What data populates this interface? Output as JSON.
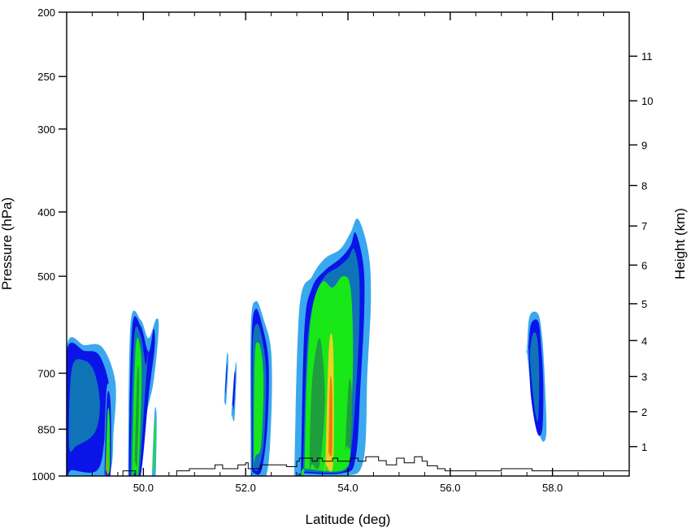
{
  "chart_data": {
    "type": "contour",
    "title": "",
    "xlabel": "Latitude (deg)",
    "ylabel": "Pressure (hPa)",
    "y2label": "Height (km)",
    "xlim": [
      48.5,
      59.5
    ],
    "ylim": [
      1000,
      200
    ],
    "y2lim": [
      0,
      11.9
    ],
    "x_ticks": [
      "50.0",
      "52.0",
      "54.0",
      "56.0",
      "58.0"
    ],
    "x_tick_values": [
      50,
      52,
      54,
      56,
      58
    ],
    "y_ticks": [
      "200",
      "250",
      "300",
      "400",
      "500",
      "700",
      "850",
      "1000"
    ],
    "y_tick_values": [
      200,
      250,
      300,
      400,
      500,
      700,
      850,
      1000
    ],
    "y2_ticks": [
      "1",
      "2",
      "3",
      "4",
      "5",
      "6",
      "7",
      "8",
      "9",
      "10",
      "11"
    ],
    "y2_tick_values": [
      1,
      2,
      3,
      4,
      5,
      6,
      7,
      8,
      9,
      10,
      11
    ],
    "y2_tick_pressures": [
      903,
      800,
      708,
      625,
      550,
      481,
      420,
      365,
      317,
      272,
      233
    ],
    "level_colors": [
      "#3aa8ee",
      "#0a14e8",
      "#0f73b8",
      "#18e818",
      "#1f9e3e",
      "#f0d020",
      "#f07814"
    ],
    "cells": [
      {
        "name": "cell-48.7",
        "rings": [
          {
            "level": 0,
            "lat": [
              48.5,
              48.5,
              48.85,
              49.2,
              49.45,
              49.42,
              49.3,
              48.6
            ],
            "p": [
              1000,
              640,
              635,
              640,
              720,
              850,
              1000,
              1000
            ]
          },
          {
            "level": 1,
            "lat": [
              48.5,
              48.5,
              48.85,
              49.15,
              49.35,
              49.25,
              49.1,
              48.6
            ],
            "p": [
              980,
              650,
              648,
              660,
              750,
              870,
              980,
              980
            ]
          },
          {
            "level": 2,
            "lat": [
              48.55,
              48.6,
              48.85,
              49.05,
              49.15,
              49.05,
              48.7
            ],
            "p": [
              900,
              690,
              670,
              700,
              780,
              860,
              900
            ]
          }
        ]
      },
      {
        "name": "cell-49.3",
        "rings": [
          {
            "level": 0,
            "lat": [
              49.22,
              49.28,
              49.38,
              49.38,
              49.3,
              49.22
            ],
            "p": [
              1000,
              740,
              760,
              900,
              1000,
              1000
            ]
          },
          {
            "level": 1,
            "lat": [
              49.24,
              49.29,
              49.36,
              49.36,
              49.24
            ],
            "p": [
              990,
              760,
              780,
              990,
              990
            ]
          },
          {
            "level": 3,
            "lat": [
              49.26,
              49.3,
              49.34,
              49.34,
              49.26
            ],
            "p": [
              980,
              800,
              820,
              980,
              980
            ]
          },
          {
            "level": 6,
            "lat": [
              49.285,
              49.31,
              49.31,
              49.285
            ],
            "p": [
              990,
              900,
              990,
              990
            ]
          }
        ]
      },
      {
        "name": "cell-49.9",
        "rings": [
          {
            "level": 0,
            "lat": [
              49.7,
              49.75,
              49.95,
              50.1,
              50.25,
              50.3,
              50.2,
              50.05,
              49.95,
              49.85,
              49.7
            ],
            "p": [
              1000,
              590,
              582,
              620,
              580,
              600,
              720,
              820,
              1000,
              1000,
              1000
            ]
          },
          {
            "level": 1,
            "lat": [
              49.72,
              49.78,
              49.95,
              50.1,
              50.2,
              50.22,
              50.1,
              49.95,
              49.8
            ],
            "p": [
              995,
              600,
              595,
              650,
              600,
              640,
              760,
              995,
              995
            ]
          },
          {
            "level": 2,
            "lat": [
              49.75,
              49.82,
              49.95,
              50.05,
              50.12,
              50.05,
              49.92,
              49.82
            ],
            "p": [
              990,
              620,
              615,
              680,
              620,
              720,
              990,
              990
            ]
          },
          {
            "level": 3,
            "lat": [
              49.78,
              49.85,
              49.95,
              49.96,
              49.9,
              49.82
            ],
            "p": [
              985,
              640,
              650,
              760,
              985,
              985
            ]
          },
          {
            "level": 4,
            "lat": [
              49.83,
              49.88,
              49.92,
              49.88,
              49.84
            ],
            "p": [
              950,
              700,
              720,
              950,
              950
            ]
          }
        ]
      },
      {
        "name": "cell-50.2",
        "rings": [
          {
            "level": 0,
            "lat": [
              50.17,
              50.22,
              50.26,
              50.24,
              50.2
            ],
            "p": [
              1000,
              800,
              820,
              1000,
              1000
            ]
          },
          {
            "level": 3,
            "lat": [
              50.19,
              50.22,
              50.24,
              50.22,
              50.2
            ],
            "p": [
              980,
              830,
              850,
              980,
              980
            ]
          }
        ]
      },
      {
        "name": "cell-51.6",
        "rings": [
          {
            "level": 0,
            "lat": [
              51.58,
              51.63,
              51.66,
              51.62,
              51.58
            ],
            "p": [
              770,
              660,
              670,
              775,
              770
            ]
          },
          {
            "level": 1,
            "lat": [
              51.6,
              51.63,
              51.64,
              51.61,
              51.6
            ],
            "p": [
              745,
              680,
              690,
              748,
              745
            ]
          }
        ]
      },
      {
        "name": "cell-51.8",
        "rings": [
          {
            "level": 0,
            "lat": [
              51.72,
              51.8,
              51.82,
              51.78,
              51.73
            ],
            "p": [
              810,
              680,
              700,
              820,
              810
            ]
          },
          {
            "level": 1,
            "lat": [
              51.74,
              51.78,
              51.8,
              51.77,
              51.75
            ],
            "p": [
              780,
              700,
              710,
              790,
              780
            ]
          }
        ]
      },
      {
        "name": "cell-52.2",
        "rings": [
          {
            "level": 0,
            "lat": [
              52.1,
              52.1,
              52.2,
              52.35,
              52.5,
              52.5,
              52.4,
              52.1
            ],
            "p": [
              1000,
              600,
              545,
              580,
              650,
              820,
              1000,
              1000
            ]
          },
          {
            "level": 1,
            "lat": [
              52.12,
              52.12,
              52.2,
              52.34,
              52.45,
              52.42,
              52.3,
              52.12
            ],
            "p": [
              985,
              620,
              560,
              600,
              680,
              850,
              985,
              985
            ]
          },
          {
            "level": 2,
            "lat": [
              52.14,
              52.14,
              52.22,
              52.32,
              52.4,
              52.36,
              52.25,
              52.14
            ],
            "p": [
              975,
              640,
              590,
              620,
              700,
              880,
              975,
              975
            ]
          },
          {
            "level": 3,
            "lat": [
              52.16,
              52.18,
              52.25,
              52.32,
              52.35,
              52.3,
              52.2
            ],
            "p": [
              930,
              660,
              630,
              660,
              740,
              900,
              930
            ]
          }
        ]
      },
      {
        "name": "cell-53.8",
        "rings": [
          {
            "level": 0,
            "lat": [
              52.95,
              53.05,
              53.3,
              53.55,
              53.85,
              54.05,
              54.2,
              54.4,
              54.45,
              54.38,
              54.3,
              53.9,
              52.95
            ],
            "p": [
              1000,
              560,
              500,
              470,
              455,
              430,
              410,
              460,
              540,
              700,
              950,
              1000,
              1000
            ]
          },
          {
            "level": 1,
            "lat": [
              53.08,
              53.15,
              53.3,
              53.55,
              53.85,
              54.05,
              54.15,
              54.3,
              54.32,
              54.25,
              54.15,
              53.9,
              53.08
            ],
            "p": [
              990,
              600,
              520,
              490,
              470,
              450,
              430,
              480,
              560,
              720,
              940,
              990,
              990
            ]
          },
          {
            "level": 2,
            "lat": [
              53.12,
              53.2,
              53.35,
              53.55,
              53.8,
              54.0,
              54.12,
              54.22,
              54.22,
              54.15,
              54.05,
              53.9,
              53.12
            ],
            "p": [
              985,
              640,
              540,
              500,
              485,
              470,
              455,
              500,
              600,
              760,
              930,
              985,
              985
            ]
          },
          {
            "level": 3,
            "lat": [
              53.15,
              53.2,
              53.3,
              53.5,
              53.7,
              53.9,
              54.05,
              54.1,
              54.05,
              53.95,
              53.15
            ],
            "p": [
              975,
              700,
              560,
              510,
              520,
              500,
              520,
              650,
              850,
              975,
              975
            ]
          },
          {
            "level": 4,
            "lat": [
              53.25,
              53.3,
              53.45,
              53.55,
              53.45,
              53.3
            ],
            "p": [
              960,
              720,
              620,
              760,
              960,
              960
            ]
          },
          {
            "level": 4,
            "lat": [
              53.95,
              54.02,
              54.08,
              54.05,
              53.98
            ],
            "p": [
              900,
              720,
              760,
              900,
              900
            ]
          },
          {
            "level": 5,
            "lat": [
              53.56,
              53.62,
              53.68,
              53.72,
              53.71,
              53.56
            ],
            "p": [
              960,
              660,
              610,
              680,
              960,
              960
            ]
          },
          {
            "level": 6,
            "lat": [
              53.62,
              53.65,
              53.69,
              53.69,
              53.62
            ],
            "p": [
              920,
              720,
              740,
              920,
              920
            ]
          }
        ]
      },
      {
        "name": "cell-57.7",
        "rings": [
          {
            "level": 0,
            "lat": [
              57.5,
              57.55,
              57.72,
              57.8,
              57.85,
              57.88,
              57.78,
              57.62,
              57.5
            ],
            "p": [
              650,
              575,
              570,
              620,
              720,
              860,
              880,
              780,
              650
            ]
          },
          {
            "level": 1,
            "lat": [
              57.53,
              57.58,
              57.72,
              57.78,
              57.82,
              57.8,
              57.7,
              57.58,
              57.53
            ],
            "p": [
              640,
              590,
              585,
              640,
              730,
              850,
              860,
              760,
              640
            ]
          },
          {
            "level": 2,
            "lat": [
              57.56,
              57.62,
              57.7,
              57.74,
              57.72,
              57.66,
              57.58
            ],
            "p": [
              650,
              610,
              620,
              700,
              820,
              800,
              700
            ]
          }
        ]
      }
    ],
    "terrain": {
      "lat": [
        48.5,
        49.6,
        49.6,
        49.85,
        49.85,
        50.65,
        50.65,
        50.9,
        50.9,
        51.4,
        51.4,
        51.55,
        51.55,
        51.85,
        51.85,
        52.0,
        52.0,
        52.05,
        52.05,
        52.3,
        52.3,
        52.8,
        52.8,
        53.0,
        53.0,
        53.05,
        53.05,
        53.3,
        53.3,
        53.4,
        53.4,
        53.5,
        53.5,
        53.7,
        53.7,
        53.8,
        53.8,
        54.05,
        54.05,
        54.2,
        54.2,
        54.35,
        54.35,
        54.6,
        54.6,
        54.75,
        54.75,
        54.95,
        54.95,
        55.1,
        55.1,
        55.3,
        55.3,
        55.45,
        55.45,
        55.55,
        55.55,
        55.75,
        55.75,
        55.9,
        55.9,
        57.0,
        57.0,
        57.6,
        57.6,
        59.5
      ],
      "p": [
        1000,
        1000,
        982,
        982,
        1000,
        1000,
        982,
        982,
        975,
        975,
        962,
        962,
        975,
        975,
        962,
        962,
        955,
        955,
        975,
        975,
        962,
        962,
        968,
        968,
        950,
        950,
        940,
        940,
        950,
        950,
        940,
        940,
        950,
        950,
        940,
        940,
        950,
        950,
        940,
        940,
        950,
        950,
        935,
        935,
        948,
        948,
        962,
        962,
        940,
        940,
        955,
        955,
        935,
        935,
        950,
        950,
        965,
        965,
        975,
        975,
        982,
        982,
        975,
        975,
        982,
        982
      ]
    }
  }
}
